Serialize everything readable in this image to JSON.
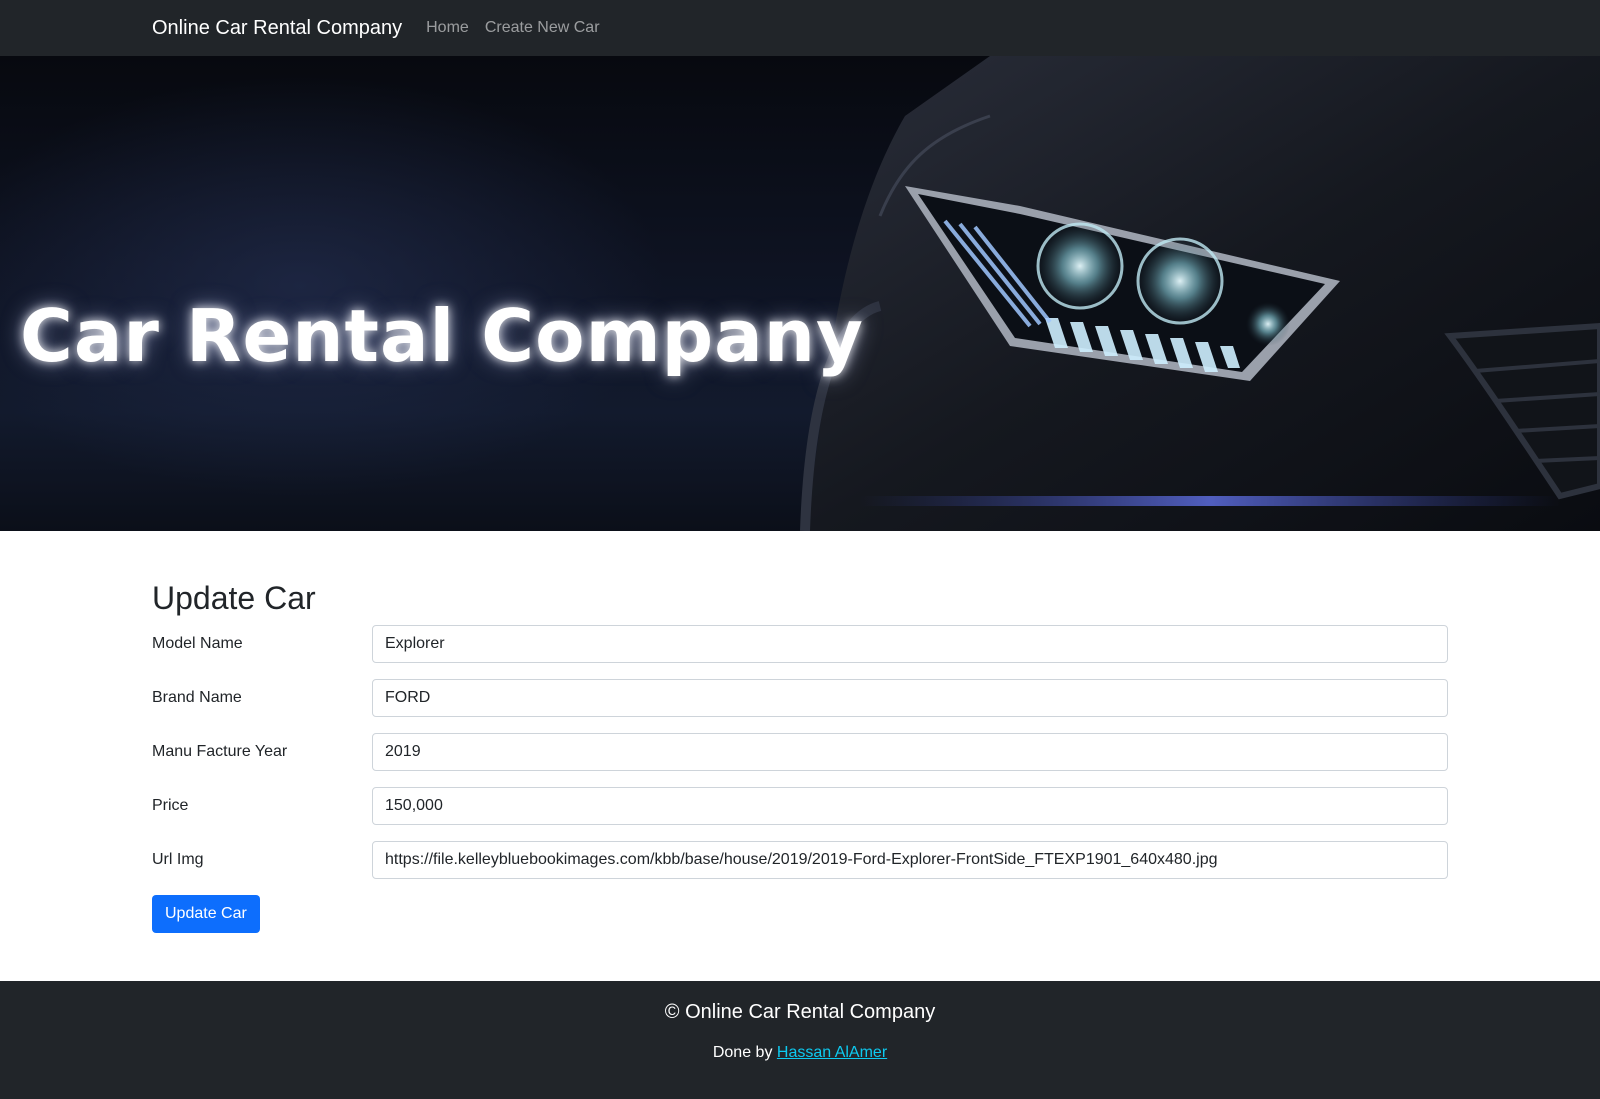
{
  "navbar": {
    "brand": "Online Car Rental Company",
    "links": [
      "Home",
      "Create New Car"
    ]
  },
  "hero": {
    "title": "Car Rental Company"
  },
  "form": {
    "title": "Update Car",
    "fields": [
      {
        "label": "Model Name",
        "value": "Explorer"
      },
      {
        "label": "Brand Name",
        "value": "FORD"
      },
      {
        "label": "Manu Facture Year",
        "value": "2019"
      },
      {
        "label": "Price",
        "value": "150,000"
      },
      {
        "label": "Url Img",
        "value": "https://file.kelleybluebookimages.com/kbb/base/house/2019/2019-Ford-Explorer-FrontSide_FTEXP1901_640x480.jpg"
      }
    ],
    "submit_label": "Update Car"
  },
  "footer": {
    "title": "© Online Car Rental Company",
    "credit_prefix": "Done by",
    "credit_name": "Hassan AlAmer"
  },
  "colors": {
    "navbar": "#212529",
    "primary": "#0d6efd",
    "link": "#0dcaf0"
  }
}
